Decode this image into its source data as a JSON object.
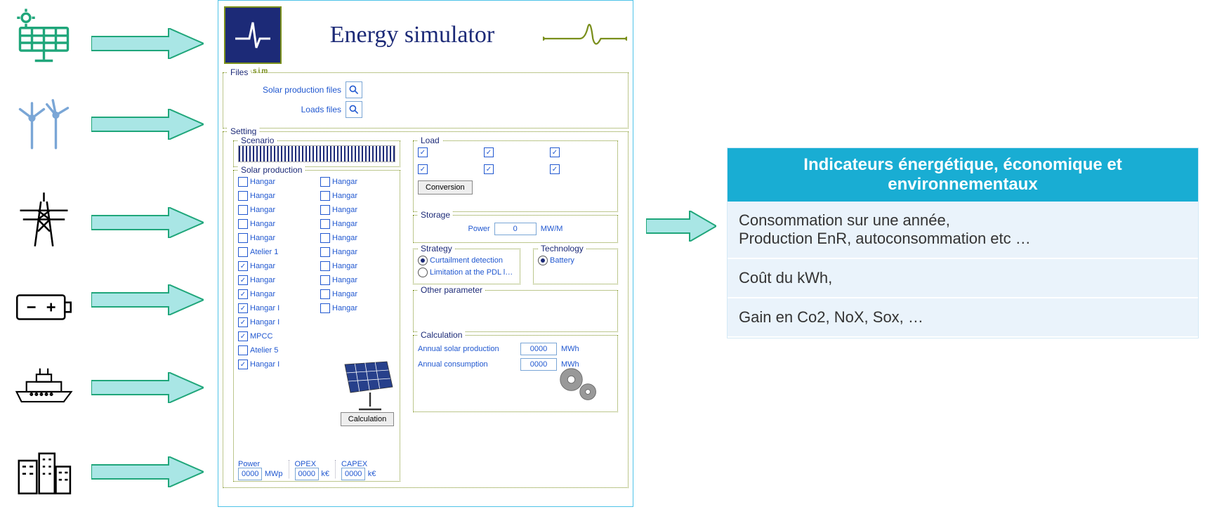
{
  "header": {
    "title": "Energy simulator",
    "logo_text": "capsim"
  },
  "files": {
    "legend": "Files",
    "solar_label": "Solar production files",
    "loads_label": "Loads files"
  },
  "setting": {
    "legend": "Setting",
    "scenario_legend": "Scenario"
  },
  "solar_prod": {
    "legend": "Solar production",
    "items": [
      {
        "label": "Hangar",
        "checked": false
      },
      {
        "label": "Hangar",
        "checked": false
      },
      {
        "label": "Hangar",
        "checked": false
      },
      {
        "label": "Hangar",
        "checked": false
      },
      {
        "label": "Hangar",
        "checked": false
      },
      {
        "label": "Hangar",
        "checked": false
      },
      {
        "label": "Hangar",
        "checked": false
      },
      {
        "label": "Hangar",
        "checked": false
      },
      {
        "label": "Hangar",
        "checked": false
      },
      {
        "label": "Hangar",
        "checked": false
      },
      {
        "label": "Atelier 1",
        "checked": false
      },
      {
        "label": "Hangar",
        "checked": false
      },
      {
        "label": "Hangar",
        "checked": true
      },
      {
        "label": "Hangar",
        "checked": false
      },
      {
        "label": "Hangar",
        "checked": true
      },
      {
        "label": "Hangar",
        "checked": false
      },
      {
        "label": "Hangar",
        "checked": true
      },
      {
        "label": "Hangar",
        "checked": false
      },
      {
        "label": "Hangar I",
        "checked": true
      },
      {
        "label": "Hangar",
        "checked": false
      },
      {
        "label": "Hangar I",
        "checked": true
      },
      {
        "label": "",
        "checked": false
      },
      {
        "label": "MPCC",
        "checked": true
      },
      {
        "label": "",
        "checked": false
      },
      {
        "label": "Atelier 5",
        "checked": false
      },
      {
        "label": "",
        "checked": false
      },
      {
        "label": "Hangar I",
        "checked": true
      },
      {
        "label": "",
        "checked": false
      }
    ],
    "calc_btn": "Calculation",
    "power_label": "Power",
    "power_val": "0000",
    "power_unit": "MWp",
    "opex_label": "OPEX",
    "opex_val": "0000",
    "opex_unit": "k€",
    "capex_label": "CAPEX",
    "capex_val": "0000",
    "capex_unit": "k€"
  },
  "load": {
    "legend": "Load",
    "items": [
      {
        "label": "",
        "checked": true
      },
      {
        "label": "",
        "checked": true
      },
      {
        "label": "",
        "checked": true
      },
      {
        "label": "",
        "checked": true
      },
      {
        "label": "",
        "checked": true
      },
      {
        "label": "",
        "checked": true
      }
    ],
    "btn": "Conversion"
  },
  "storage": {
    "legend": "Storage",
    "power_label": "Power",
    "power_val": "0",
    "power_unit": "MW/M"
  },
  "strategy": {
    "legend": "Strategy",
    "opt1": "Curtailment detection",
    "opt2": "Limitation at the PDL l…",
    "selected": 1
  },
  "technology": {
    "legend": "Technology",
    "opt": "Battery"
  },
  "other": {
    "legend": "Other parameter"
  },
  "calc": {
    "legend": "Calculation",
    "annual_prod_label": "Annual solar production",
    "annual_prod_val": "0000",
    "annual_prod_unit": "MWh",
    "annual_cons_label": "Annual consumption",
    "annual_cons_val": "0000",
    "annual_cons_unit": "MWh"
  },
  "outputs": {
    "header": "Indicateurs énergétique, économique et environnementaux",
    "rows": [
      "Consommation sur une année,\nProduction EnR, autoconsommation etc …",
      "Coût du kWh,",
      "Gain en Co2, NoX, Sox, …"
    ]
  },
  "inputs": {
    "names": [
      "solar",
      "wind",
      "grid",
      "battery",
      "ship",
      "city"
    ]
  },
  "colors": {
    "arrow_fill": "#a9e6e5",
    "arrow_stroke": "#1fa67a",
    "accent": "#7a8f1c",
    "deep": "#1c2a77",
    "output": "#19add3"
  }
}
